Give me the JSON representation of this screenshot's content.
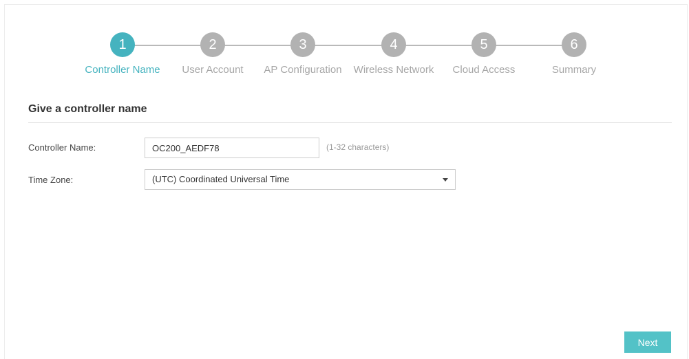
{
  "wizard": {
    "steps": [
      {
        "number": "1",
        "label": "Controller Name",
        "active": true
      },
      {
        "number": "2",
        "label": "User Account",
        "active": false
      },
      {
        "number": "3",
        "label": "AP Configuration",
        "active": false
      },
      {
        "number": "4",
        "label": "Wireless Network",
        "active": false
      },
      {
        "number": "5",
        "label": "Cloud Access",
        "active": false
      },
      {
        "number": "6",
        "label": "Summary",
        "active": false
      }
    ]
  },
  "form": {
    "section_title": "Give a controller name",
    "controller_name": {
      "label": "Controller Name:",
      "value": "OC200_AEDF78",
      "hint": "(1-32 characters)"
    },
    "time_zone": {
      "label": "Time Zone:",
      "selected": "(UTC) Coordinated Universal Time"
    }
  },
  "footer": {
    "next_label": "Next"
  },
  "colors": {
    "accent": "#45b3bf",
    "inactive_step": "#b2b2b2",
    "button": "#53c2c7"
  },
  "icons": {
    "dropdown": "chevron-down-icon"
  }
}
